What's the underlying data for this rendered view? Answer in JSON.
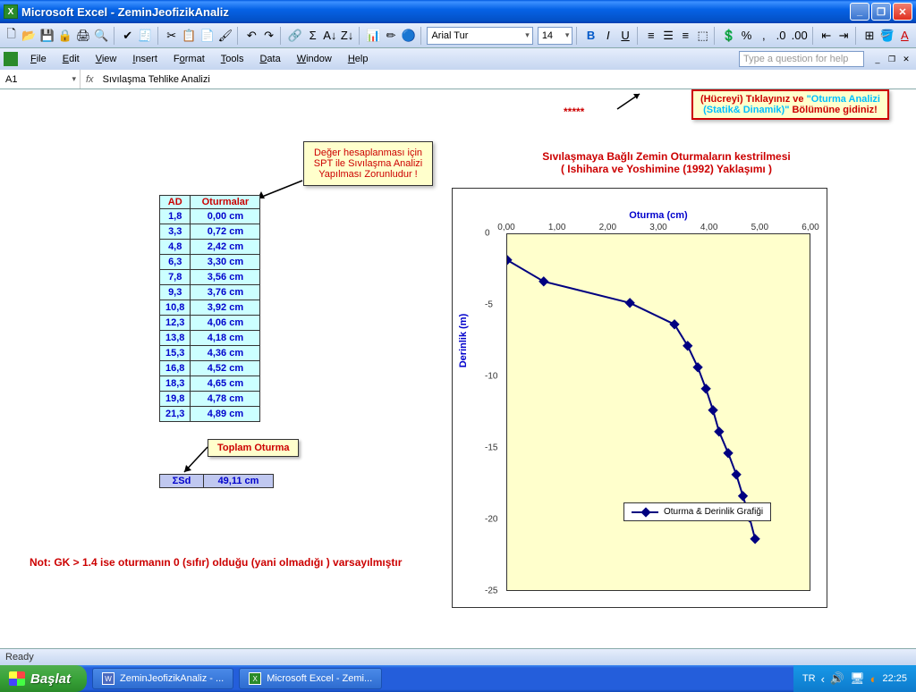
{
  "window": {
    "app": "Microsoft Excel",
    "doc": "ZeminJeofizikAnaliz"
  },
  "menus": [
    "File",
    "Edit",
    "View",
    "Insert",
    "Format",
    "Tools",
    "Data",
    "Window",
    "Help"
  ],
  "question_placeholder": "Type a question for help",
  "font": {
    "name": "Arial Tur",
    "size": "14"
  },
  "cellref": "A1",
  "fx": "fx",
  "formula": "Sıvılaşma Tehlike Analizi",
  "callout1": {
    "l1": "Değer hesaplanması için",
    "l2": "SPT ile Sıvılaşma Analizi",
    "l3": "Yapılması Zorunludur !"
  },
  "topcallout": {
    "l1a": "(Hücreyi) Tıklayınız ve ",
    "l1b": "\"Oturma Analizi",
    "l2a": "(Statik& Dinamik)\"",
    "l2b": " Bölümüne gidiniz!"
  },
  "stars": "*****",
  "table": {
    "h1": "AD",
    "h2": "Oturmalar",
    "rows": [
      {
        "a": "1,8",
        "b": "0,00  cm"
      },
      {
        "a": "3,3",
        "b": "0,72  cm"
      },
      {
        "a": "4,8",
        "b": "2,42  cm"
      },
      {
        "a": "6,3",
        "b": "3,30  cm"
      },
      {
        "a": "7,8",
        "b": "3,56  cm"
      },
      {
        "a": "9,3",
        "b": "3,76  cm"
      },
      {
        "a": "10,8",
        "b": "3,92  cm"
      },
      {
        "a": "12,3",
        "b": "4,06  cm"
      },
      {
        "a": "13,8",
        "b": "4,18  cm"
      },
      {
        "a": "15,3",
        "b": "4,36  cm"
      },
      {
        "a": "16,8",
        "b": "4,52  cm"
      },
      {
        "a": "18,3",
        "b": "4,65  cm"
      },
      {
        "a": "19,8",
        "b": "4,78  cm"
      },
      {
        "a": "21,3",
        "b": "4,89  cm"
      }
    ]
  },
  "total_label": "Toplam Oturma",
  "sum": {
    "l": "ΣSd",
    "v": "49,11  cm"
  },
  "note": "Not: GK > 1.4 ise oturmanın 0 (sıfır) olduğu (yani olmadığı ) varsayılmıştır",
  "chart": {
    "title1": "Sıvılaşmaya Bağlı Zemin Oturmaların kestrilmesi",
    "title2": "( Ishihara ve Yoshimine (1992) Yaklaşımı )",
    "xlabel": "Oturma  (cm)",
    "ylabel": "Derinlik (m)",
    "xticks": [
      "0,00",
      "1,00",
      "2,00",
      "3,00",
      "4,00",
      "5,00",
      "6,00"
    ],
    "yticks": [
      "0",
      "-5",
      "-10",
      "-15",
      "-20",
      "-25"
    ],
    "legend": "Oturma & Derinlik Grafiği"
  },
  "chart_data": {
    "type": "line",
    "title": "Sıvılaşmaya Bağlı Zemin Oturmaların kestrilmesi ( Ishihara ve Yoshimine (1992) Yaklaşımı )",
    "xlabel": "Oturma (cm)",
    "ylabel": "Derinlik (m)",
    "xlim": [
      0,
      6
    ],
    "ylim": [
      -25,
      0
    ],
    "series": [
      {
        "name": "Oturma & Derinlik Grafiği",
        "x": [
          0.0,
          0.72,
          2.42,
          3.3,
          3.56,
          3.76,
          3.92,
          4.06,
          4.18,
          4.36,
          4.52,
          4.65,
          4.78,
          4.89
        ],
        "y": [
          -1.8,
          -3.3,
          -4.8,
          -6.3,
          -7.8,
          -9.3,
          -10.8,
          -12.3,
          -13.8,
          -15.3,
          -16.8,
          -18.3,
          -19.8,
          -21.3
        ]
      }
    ]
  },
  "status": "Ready",
  "taskbar": {
    "start": "Başlat",
    "items": [
      "ZeminJeofizikAnaliz - ...",
      "Microsoft Excel - Zemi..."
    ],
    "lang": "TR",
    "clock": "22:25"
  }
}
